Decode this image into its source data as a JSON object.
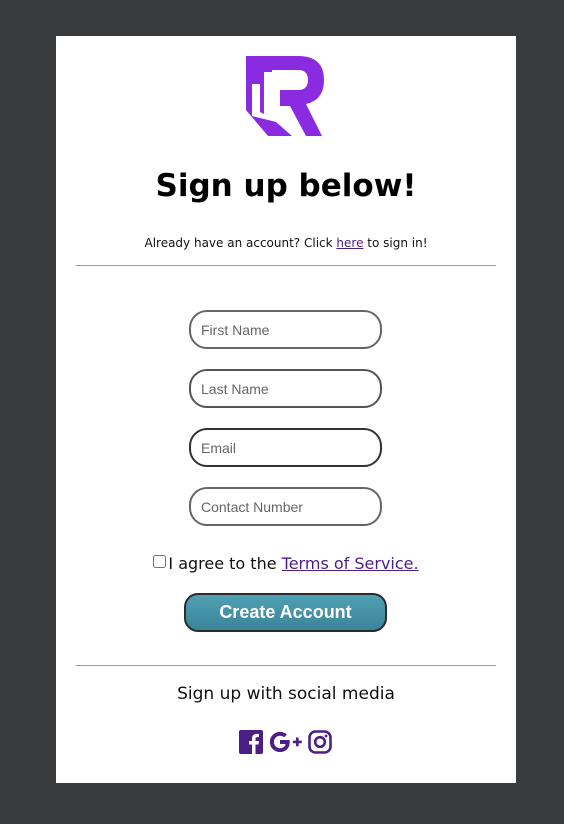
{
  "header": {
    "logo_icon": "R-logo-icon",
    "title": "Sign up below!",
    "subtitle_prefix": "Already have an account? Click ",
    "signin_link": "here",
    "subtitle_suffix": " to sign in!"
  },
  "form": {
    "first_name_placeholder": "First Name",
    "last_name_placeholder": "Last Name",
    "email_placeholder": "Email",
    "contact_placeholder": "Contact Number",
    "agree_prefix": "I agree to the ",
    "terms_link": "Terms of Service.",
    "create_button": "Create Account"
  },
  "social": {
    "title": "Sign up with social media",
    "icons": [
      "facebook-icon",
      "google-plus-icon",
      "instagram-icon"
    ]
  },
  "colors": {
    "background": "#3a3b3d",
    "accent_purple": "#4b1f86",
    "logo_purple": "#8a2be2",
    "button_teal": "#3b8499"
  }
}
